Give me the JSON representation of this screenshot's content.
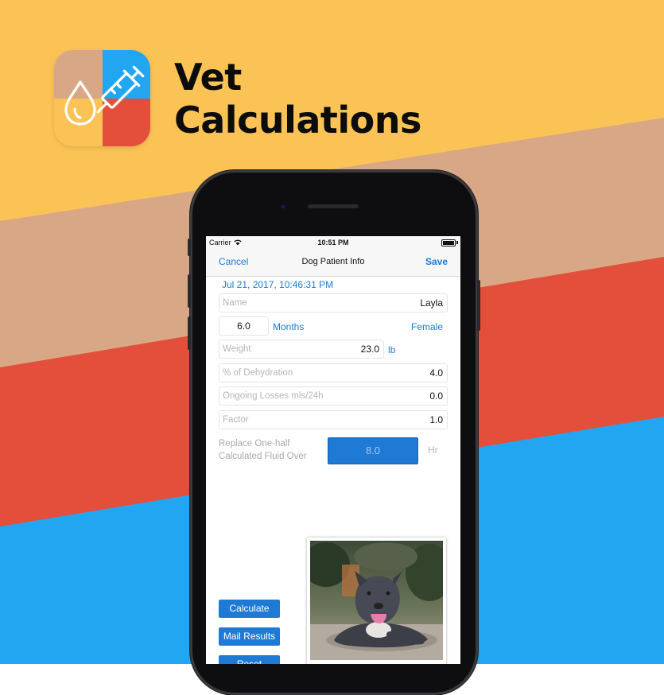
{
  "promo": {
    "title_line1": "Vet",
    "title_line2": "Calculations"
  },
  "colors": {
    "yellow": "#fbc356",
    "tan": "#d8a886",
    "red": "#e34f3a",
    "blue": "#22a6f1",
    "ios_blue": "#1a7bd5"
  },
  "icons": {
    "app_icon": "drop-and-syringe-icon",
    "wifi": "wifi-icon",
    "battery": "battery-icon"
  },
  "statusbar": {
    "carrier": "Carrier",
    "time": "10:51 PM"
  },
  "navbar": {
    "cancel": "Cancel",
    "title": "Dog Patient Info",
    "save": "Save"
  },
  "form": {
    "date": "Jul 21, 2017, 10:46:31 PM",
    "name_placeholder": "Name",
    "name_value": "Layla",
    "age_value": "6.0",
    "age_unit": "Months",
    "sex": "Female",
    "weight_placeholder": "Weight",
    "weight_value": "23.0",
    "weight_unit": "lb",
    "dehydration_placeholder": "% of Dehydration",
    "dehydration_value": "4.0",
    "losses_placeholder": "Ongoing Losses mls/24h",
    "losses_value": "0.0",
    "factor_placeholder": "Factor",
    "factor_value": "1.0",
    "replace_label_line1": "Replace One-half",
    "replace_label_line2": "Calculated Fluid Over",
    "hours_value": "8.0",
    "hours_unit": "Hr"
  },
  "actions": {
    "calculate": "Calculate",
    "mail_results": "Mail Results",
    "reset": "Reset"
  },
  "photo": {
    "subject": "dog-photo"
  }
}
